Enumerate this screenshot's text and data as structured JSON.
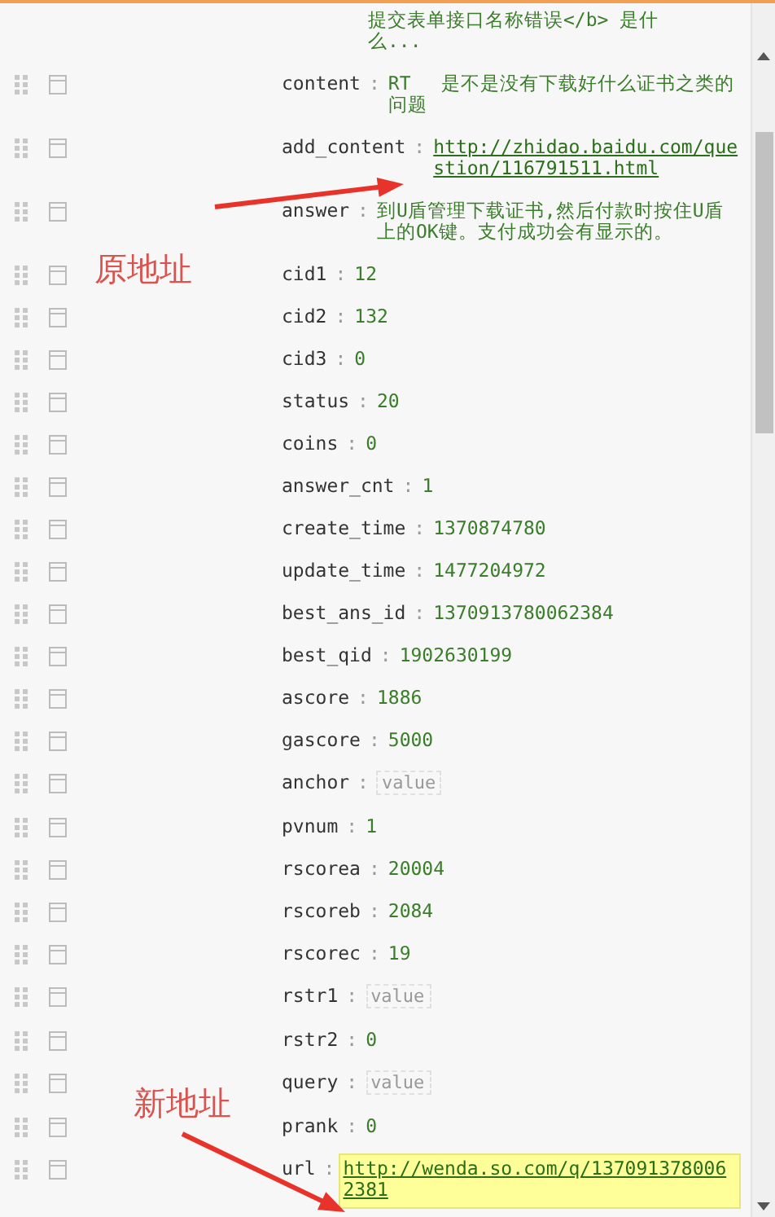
{
  "rows": [
    {
      "kind": "text",
      "value": "提交表单接口名称错误</b> 是什么..."
    },
    {
      "kind": "text",
      "key": "content",
      "separator": ":",
      "value": "RT　 是不是没有下载好什么证书之类的问题",
      "highlighted": false
    },
    {
      "kind": "link",
      "key": "add_content",
      "separator": ":",
      "value": "http://zhidao.baidu.com/question/116791511.html",
      "highlighted": false
    },
    {
      "kind": "text",
      "key": "answer",
      "separator": ":",
      "value": " 到U盾管理下载证书,然后付款时按住U盾上的OK键。支付成功会有显示的。",
      "highlighted": false
    },
    {
      "kind": "text",
      "key": "cid1",
      "separator": ":",
      "value": "12",
      "highlighted": false
    },
    {
      "kind": "text",
      "key": "cid2",
      "separator": ":",
      "value": "132",
      "highlighted": false
    },
    {
      "kind": "text",
      "key": "cid3",
      "separator": ":",
      "value": "0",
      "highlighted": false
    },
    {
      "kind": "text",
      "key": "status",
      "separator": ":",
      "value": "20",
      "highlighted": false
    },
    {
      "kind": "text",
      "key": "coins",
      "separator": ":",
      "value": "0",
      "highlighted": false
    },
    {
      "kind": "text",
      "key": "answer_cnt",
      "separator": ":",
      "value": "1",
      "highlighted": false
    },
    {
      "kind": "text",
      "key": "create_time",
      "separator": ":",
      "value": "1370874780",
      "highlighted": false
    },
    {
      "kind": "text",
      "key": "update_time",
      "separator": ":",
      "value": "1477204972",
      "highlighted": false
    },
    {
      "kind": "text",
      "key": "best_ans_id",
      "separator": ":",
      "value": "1370913780062384",
      "highlighted": false
    },
    {
      "kind": "text",
      "key": "best_qid",
      "separator": ":",
      "value": "1902630199",
      "highlighted": false
    },
    {
      "kind": "text",
      "key": "ascore",
      "separator": ":",
      "value": "1886",
      "highlighted": false
    },
    {
      "kind": "text",
      "key": "gascore",
      "separator": ":",
      "value": "5000",
      "highlighted": false
    },
    {
      "kind": "empty",
      "key": "anchor",
      "separator": ":",
      "placeholder": "value",
      "highlighted": false
    },
    {
      "kind": "text",
      "key": "pvnum",
      "separator": ":",
      "value": "1",
      "highlighted": false
    },
    {
      "kind": "text",
      "key": "rscorea",
      "separator": ":",
      "value": "20004",
      "highlighted": false
    },
    {
      "kind": "text",
      "key": "rscoreb",
      "separator": ":",
      "value": "2084",
      "highlighted": false
    },
    {
      "kind": "text",
      "key": "rscorec",
      "separator": ":",
      "value": "19",
      "highlighted": false
    },
    {
      "kind": "empty",
      "key": "rstr1",
      "separator": ":",
      "placeholder": "value",
      "highlighted": false
    },
    {
      "kind": "text",
      "key": "rstr2",
      "separator": ":",
      "value": "0",
      "highlighted": false
    },
    {
      "kind": "empty",
      "key": "query",
      "separator": ":",
      "placeholder": "value",
      "highlighted": false
    },
    {
      "kind": "text",
      "key": "prank",
      "separator": ":",
      "value": "0",
      "highlighted": false
    },
    {
      "kind": "link",
      "key": "url",
      "separator": ":",
      "value": "http://wenda.so.com/q/1370913780062381",
      "highlighted": true
    }
  ],
  "annotations": [
    {
      "label": "原地址"
    },
    {
      "label": "新地址"
    }
  ]
}
